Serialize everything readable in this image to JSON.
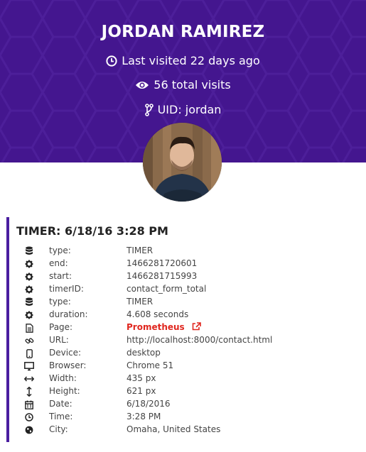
{
  "profile": {
    "name": "JORDAN RAMIREZ",
    "last_visited": "Last visited 22 days ago",
    "total_visits": "56 total visits",
    "uid": "UID: jordan",
    "colors": {
      "header_bg": "#44168f",
      "accent": "#4a1ea0",
      "link": "#e0271f"
    }
  },
  "event": {
    "title": "TIMER: 6/18/16 3:28 PM",
    "rows": [
      {
        "icon": "database-icon",
        "key": "type:",
        "value": "TIMER"
      },
      {
        "icon": "gear-icon",
        "key": "end:",
        "value": "1466281720601"
      },
      {
        "icon": "gear-icon",
        "key": "start:",
        "value": "1466281715993"
      },
      {
        "icon": "gear-icon",
        "key": "timerID:",
        "value": "contact_form_total"
      },
      {
        "icon": "database-icon",
        "key": "type:",
        "value": "TIMER"
      },
      {
        "icon": "gear-icon",
        "key": "duration:",
        "value": "4.608 seconds"
      },
      {
        "icon": "file-icon",
        "key": "Page:",
        "value": "Prometheus"
      },
      {
        "icon": "link-icon",
        "key": "URL:",
        "value": "http://localhost:8000/contact.html"
      },
      {
        "icon": "mobile-icon",
        "key": "Device:",
        "value": "desktop"
      },
      {
        "icon": "monitor-icon",
        "key": "Browser:",
        "value": "Chrome 51"
      },
      {
        "icon": "arrows-horizontal-icon",
        "key": "Width:",
        "value": "435 px"
      },
      {
        "icon": "arrows-vertical-icon",
        "key": "Height:",
        "value": "621 px"
      },
      {
        "icon": "calendar-icon",
        "key": "Date:",
        "value": "6/18/2016"
      },
      {
        "icon": "clock-icon",
        "key": "Time:",
        "value": "3:28 PM"
      },
      {
        "icon": "globe-icon",
        "key": "City:",
        "value": "Omaha, United States"
      }
    ]
  }
}
